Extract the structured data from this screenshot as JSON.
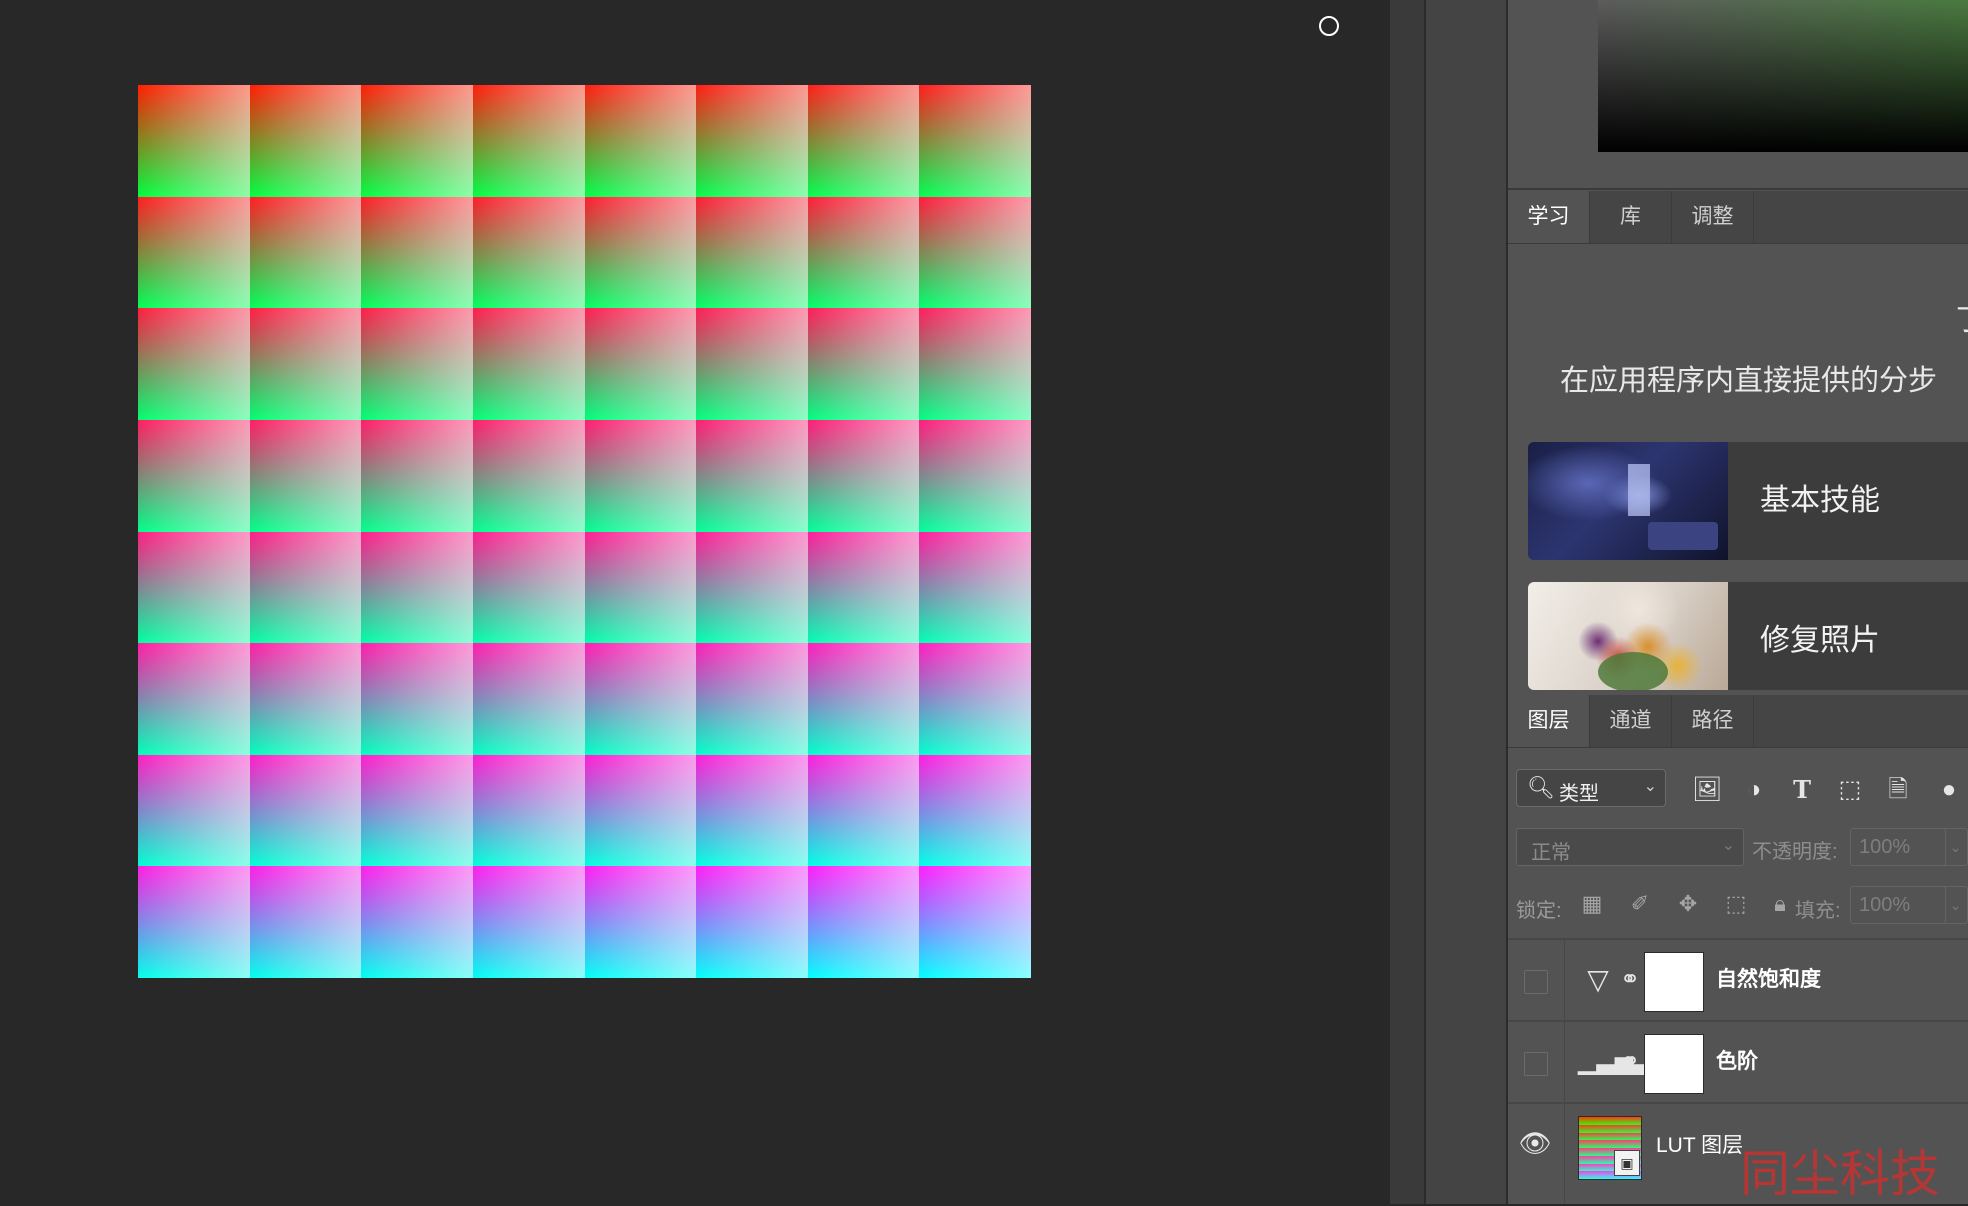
{
  "colors": {
    "canvas_bg": "#282828",
    "panel_bg": "#535353",
    "tab_active_text": "#ffffff",
    "watermark": "#c7322f"
  },
  "lut": {
    "grid": 8,
    "description_only_visual": true
  },
  "learn_panel": {
    "tabs": [
      {
        "label": "学习",
        "active": true
      },
      {
        "label": "库",
        "active": false
      },
      {
        "label": "调整",
        "active": false
      }
    ],
    "heading_glyph": "丁",
    "subtitle": "在应用程序内直接提供的分步",
    "lessons": [
      {
        "title": "基本技能"
      },
      {
        "title": "修复照片"
      }
    ]
  },
  "layers_panel": {
    "tabs": [
      {
        "label": "图层",
        "active": true
      },
      {
        "label": "通道",
        "active": false
      },
      {
        "label": "路径",
        "active": false
      }
    ],
    "filter": {
      "label": "类型",
      "icon": "search-icon",
      "chevron": "chevron-down-icon"
    },
    "filter_icons": [
      "image-filter-icon",
      "adjustment-filter-icon",
      "type-filter-icon",
      "shape-filter-icon",
      "smart-object-filter-icon"
    ],
    "blend_mode": "正常",
    "opacity_label": "不透明度:",
    "opacity_value": "100%",
    "lock_label": "锁定:",
    "fill_label": "填充:",
    "fill_value": "100%",
    "layers": [
      {
        "name": "自然饱和度",
        "visible": false,
        "type": "vibrance",
        "icon": "vibrance-icon"
      },
      {
        "name": "色阶",
        "visible": false,
        "type": "levels",
        "icon": "levels-icon"
      },
      {
        "name": "LUT 图层",
        "visible": true,
        "type": "smart-object",
        "icon": "eye-icon"
      }
    ]
  },
  "watermark": "同尘科技"
}
